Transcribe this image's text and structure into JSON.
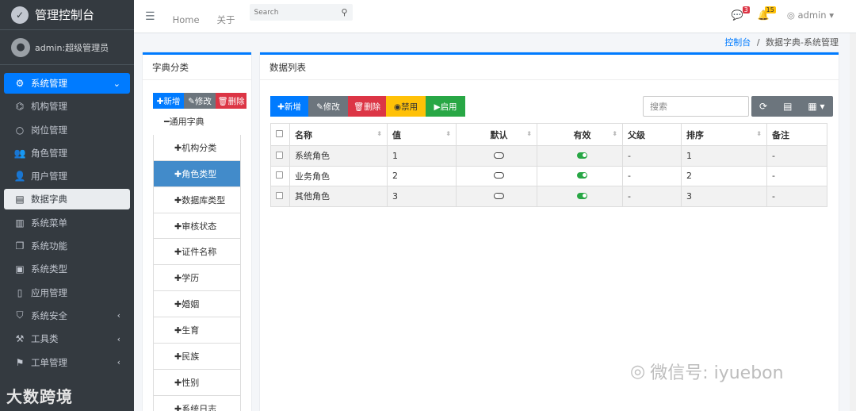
{
  "brand": {
    "title": "管理控制台"
  },
  "user": {
    "name": "admin:超级管理员"
  },
  "sidebar": {
    "items": [
      {
        "label": "系统管理",
        "icon": "gears-icon",
        "chevron": "⌄"
      },
      {
        "label": "机构管理",
        "icon": "sitemap-icon"
      },
      {
        "label": "岗位管理",
        "icon": "circle-icon"
      },
      {
        "label": "角色管理",
        "icon": "user-group-icon"
      },
      {
        "label": "用户管理",
        "icon": "users-icon"
      },
      {
        "label": "数据字典",
        "icon": "book-icon"
      },
      {
        "label": "系统菜单",
        "icon": "book-open-icon"
      },
      {
        "label": "系统功能",
        "icon": "files-icon"
      },
      {
        "label": "系统类型",
        "icon": "briefcase-icon"
      },
      {
        "label": "应用管理",
        "icon": "tablet-icon"
      },
      {
        "label": "系统安全",
        "icon": "shield-icon",
        "chevron": "‹"
      },
      {
        "label": "工具类",
        "icon": "toolbox-icon",
        "chevron": "‹"
      },
      {
        "label": "工单管理",
        "icon": "flag-icon",
        "chevron": "‹"
      }
    ]
  },
  "watermarks": {
    "left": "大数跨境",
    "right": "微信号: iyuebon"
  },
  "navbar": {
    "home": "Home",
    "about": "关于",
    "search_placeholder": "Search",
    "badge1": "3",
    "badge2": "15",
    "user": "admin"
  },
  "breadcrumb": {
    "home": "控制台",
    "sep": "/",
    "current": "数据字典-系统管理"
  },
  "left_panel": {
    "title": "字典分类",
    "buttons": {
      "add": "✚新增",
      "edit": "✎修改",
      "delete": "🗑删除"
    },
    "tree": [
      {
        "label": "━通用字典"
      },
      {
        "label": "✚机构分类"
      },
      {
        "label": "✚角色类型"
      },
      {
        "label": "✚数据库类型"
      },
      {
        "label": "✚审核状态"
      },
      {
        "label": "✚证件名称"
      },
      {
        "label": "✚学历"
      },
      {
        "label": "✚婚姻"
      },
      {
        "label": "✚生育"
      },
      {
        "label": "✚民族"
      },
      {
        "label": "✚性别"
      },
      {
        "label": "✚系统日志"
      }
    ]
  },
  "right_panel": {
    "title": "数据列表",
    "buttons": {
      "add": "✚新增",
      "edit": "✎修改",
      "delete": "🗑删除",
      "disable": "◉禁用",
      "enable": "▶启用"
    },
    "search_placeholder": "搜索",
    "columns": [
      "名称",
      "值",
      "默认",
      "有效",
      "父级",
      "排序",
      "备注"
    ],
    "rows": [
      {
        "name": "系统角色",
        "value": "1",
        "default": false,
        "valid": true,
        "parent": "-",
        "order": "1",
        "remark": "-"
      },
      {
        "name": "业务角色",
        "value": "2",
        "default": false,
        "valid": true,
        "parent": "-",
        "order": "2",
        "remark": "-"
      },
      {
        "name": "其他角色",
        "value": "3",
        "default": false,
        "valid": true,
        "parent": "-",
        "order": "3",
        "remark": "-"
      }
    ]
  },
  "colors": {
    "primary": "#007bff",
    "sidebar": "#343a40",
    "danger": "#dc3545",
    "warning": "#ffc107",
    "success": "#28a745",
    "secondary": "#6c757d"
  }
}
